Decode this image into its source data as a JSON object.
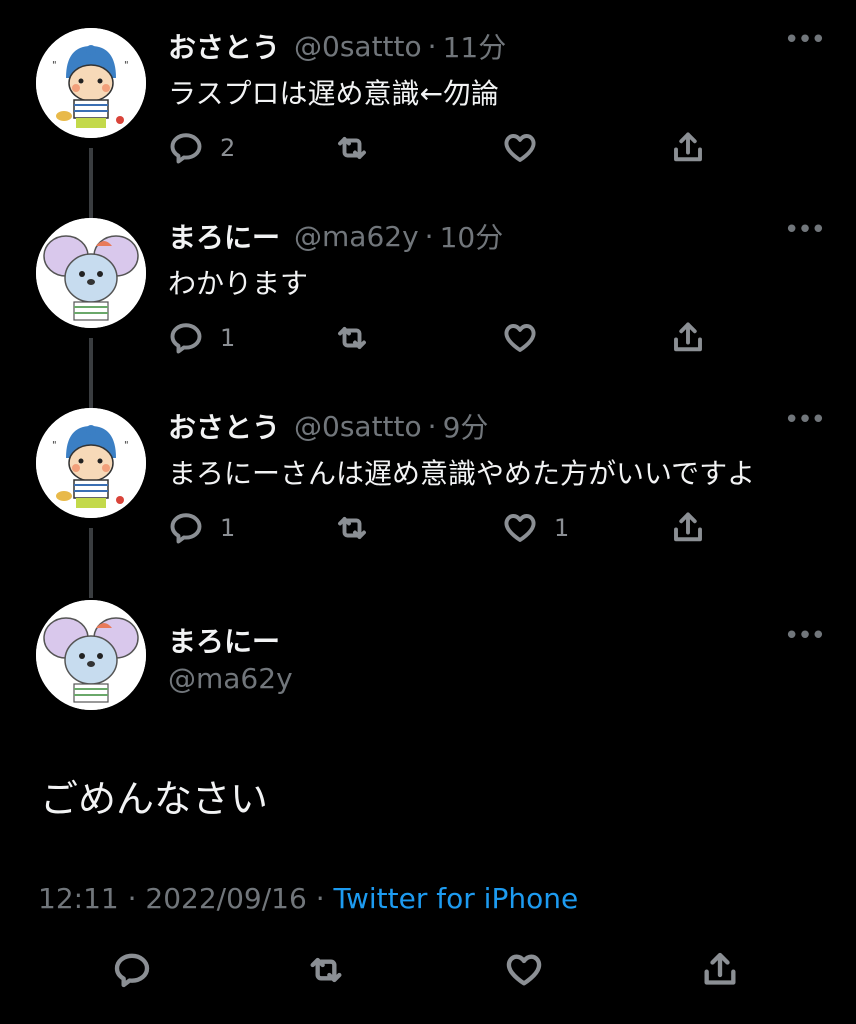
{
  "tweets": [
    {
      "name": "おさとう",
      "handle": "@0sattto",
      "sep": "·",
      "time": "11分",
      "text": "ラスプロは遅め意識←勿論",
      "reply_count": "2",
      "retweet_count": "",
      "like_count": ""
    },
    {
      "name": "まろにー",
      "handle": "@ma62y",
      "sep": "·",
      "time": "10分",
      "text": "わかります",
      "reply_count": "1",
      "retweet_count": "",
      "like_count": ""
    },
    {
      "name": "おさとう",
      "handle": "@0sattto",
      "sep": "·",
      "time": "9分",
      "text": "まろにーさんは遅め意識やめた方がいいですよ",
      "reply_count": "1",
      "retweet_count": "",
      "like_count": "1"
    }
  ],
  "main_tweet": {
    "name": "まろにー",
    "handle": "@ma62y",
    "text": "ごめんなさい",
    "time": "12:11",
    "sep": "·",
    "date": "2022/09/16",
    "sep2": "·",
    "source": "Twitter for iPhone"
  },
  "icons": {
    "reply": "reply-icon",
    "retweet": "retweet-icon",
    "like": "heart-icon",
    "share": "share-icon",
    "more": "more-icon"
  },
  "colors": {
    "background": "#000000",
    "text": "#e7e9ea",
    "muted": "#71767b",
    "link": "#1d9bf0"
  }
}
